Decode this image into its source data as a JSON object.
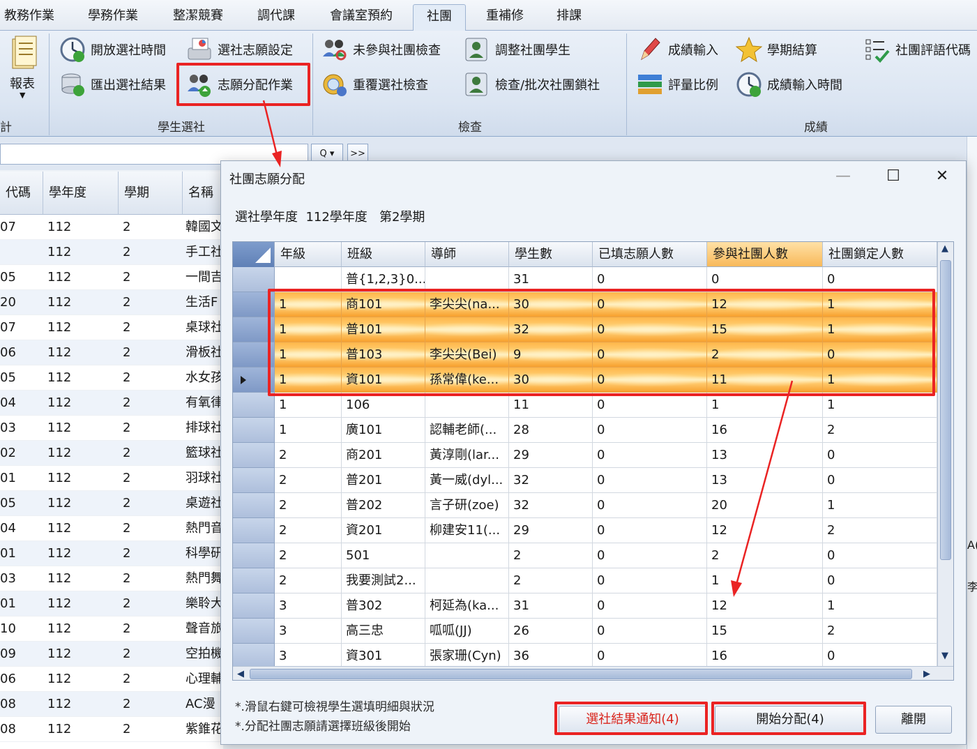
{
  "tabs": [
    {
      "label": "教務作業",
      "active": false
    },
    {
      "label": "學務作業",
      "active": false
    },
    {
      "label": "整潔競賽",
      "active": false
    },
    {
      "label": "調代課",
      "active": false
    },
    {
      "label": "會議室預約",
      "active": false
    },
    {
      "label": "社團",
      "active": true
    },
    {
      "label": "重補修",
      "active": false
    },
    {
      "label": "排課",
      "active": false
    }
  ],
  "ribbon": {
    "report_label": "報表",
    "partial_group_label": "計",
    "groups": {
      "select": "學生選社",
      "check": "檢查",
      "grade": "成績"
    },
    "buttons": {
      "open_time": "開放選社時間",
      "pref_setting": "選社志願設定",
      "export_result": "匯出選社結果",
      "pref_assign": "志願分配作業",
      "not_joined_check": "未參與社團檢查",
      "adjust_students": "調整社團學生",
      "duplicate_check": "重覆選社檢查",
      "check_lock": "檢查/批次社團鎖社",
      "grade_input": "成績輸入",
      "semester_settle": "學期結算",
      "comment_code": "社團評語代碼",
      "ratio": "評量比例",
      "grade_time": "成績輸入時間"
    }
  },
  "search": {
    "search_button": "Q ▾",
    "more_button": ">>"
  },
  "background_grid": {
    "headers": [
      "代碼",
      "學年度",
      "學期",
      "名稱"
    ],
    "rows": [
      [
        "07",
        "112",
        "2",
        "韓國文"
      ],
      [
        "",
        "112",
        "2",
        "手工社"
      ],
      [
        "05",
        "112",
        "2",
        "一間吉"
      ],
      [
        "20",
        "112",
        "2",
        "生活F"
      ],
      [
        "07",
        "112",
        "2",
        "桌球社"
      ],
      [
        "06",
        "112",
        "2",
        "滑板社"
      ],
      [
        "05",
        "112",
        "2",
        "水女孩"
      ],
      [
        "04",
        "112",
        "2",
        "有氧律"
      ],
      [
        "03",
        "112",
        "2",
        "排球社"
      ],
      [
        "02",
        "112",
        "2",
        "籃球社"
      ],
      [
        "01",
        "112",
        "2",
        "羽球社"
      ],
      [
        "05",
        "112",
        "2",
        "桌遊社"
      ],
      [
        "04",
        "112",
        "2",
        "熱門音"
      ],
      [
        "01",
        "112",
        "2",
        "科學研"
      ],
      [
        "03",
        "112",
        "2",
        "熱門舞"
      ],
      [
        "01",
        "112",
        "2",
        "樂聆大"
      ],
      [
        "10",
        "112",
        "2",
        "聲音旅"
      ],
      [
        "09",
        "112",
        "2",
        "空拍機"
      ],
      [
        "06",
        "112",
        "2",
        "心理輔"
      ],
      [
        "08",
        "112",
        "2",
        "AC漫"
      ],
      [
        "08",
        "112",
        "2",
        "紫錐花"
      ]
    ]
  },
  "right_peek": {
    "a": "A(",
    "b": "李"
  },
  "dialog": {
    "title": "社團志願分配",
    "min": "—",
    "max": "☐",
    "close": "✕",
    "year_label": "選社學年度",
    "year_value": "112學年度",
    "semester_value": "第2學期",
    "columns": [
      "年級",
      "班級",
      "導師",
      "學生數",
      "已填志願人數",
      "參與社團人數",
      "社團鎖定人數"
    ],
    "highlighted_column": 5,
    "rows": [
      {
        "grade": "",
        "class": "普{1,2,3}0...",
        "teacher": "",
        "students": "31",
        "filled": "0",
        "joined": "0",
        "locked": "0"
      },
      {
        "grade": "1",
        "class": "商101",
        "teacher": "李尖尖(na...",
        "students": "30",
        "filled": "0",
        "joined": "12",
        "locked": "1"
      },
      {
        "grade": "1",
        "class": "普101",
        "teacher": "",
        "students": "32",
        "filled": "0",
        "joined": "15",
        "locked": "1"
      },
      {
        "grade": "1",
        "class": "普103",
        "teacher": "李尖尖(Bei)",
        "students": "9",
        "filled": "0",
        "joined": "2",
        "locked": "0"
      },
      {
        "grade": "1",
        "class": "資101",
        "teacher": "孫常偉(ke...",
        "students": "30",
        "filled": "0",
        "joined": "11",
        "locked": "1"
      },
      {
        "grade": "1",
        "class": "106",
        "teacher": "",
        "students": "11",
        "filled": "0",
        "joined": "1",
        "locked": "1"
      },
      {
        "grade": "1",
        "class": "廣101",
        "teacher": "認輔老師(...",
        "students": "28",
        "filled": "0",
        "joined": "16",
        "locked": "2"
      },
      {
        "grade": "2",
        "class": "商201",
        "teacher": "黃淳剛(lar...",
        "students": "29",
        "filled": "0",
        "joined": "13",
        "locked": "0"
      },
      {
        "grade": "2",
        "class": "普201",
        "teacher": "黃一威(dyl...",
        "students": "32",
        "filled": "0",
        "joined": "13",
        "locked": "0"
      },
      {
        "grade": "2",
        "class": "普202",
        "teacher": "言子研(zoe)",
        "students": "32",
        "filled": "0",
        "joined": "20",
        "locked": "1"
      },
      {
        "grade": "2",
        "class": "資201",
        "teacher": "柳建安11(...",
        "students": "29",
        "filled": "0",
        "joined": "12",
        "locked": "2"
      },
      {
        "grade": "2",
        "class": "501",
        "teacher": "",
        "students": "2",
        "filled": "0",
        "joined": "2",
        "locked": "0"
      },
      {
        "grade": "2",
        "class": "我要測試2...",
        "teacher": "",
        "students": "2",
        "filled": "0",
        "joined": "1",
        "locked": "0"
      },
      {
        "grade": "3",
        "class": "普302",
        "teacher": "柯延為(ka...",
        "students": "31",
        "filled": "0",
        "joined": "12",
        "locked": "1"
      },
      {
        "grade": "3",
        "class": "高三忠",
        "teacher": "呱呱(JJ)",
        "students": "26",
        "filled": "0",
        "joined": "15",
        "locked": "2"
      },
      {
        "grade": "3",
        "class": "資301",
        "teacher": "張家珊(Cyn)",
        "students": "36",
        "filled": "0",
        "joined": "16",
        "locked": "0"
      }
    ],
    "selected_rows": [
      1,
      2,
      3,
      4
    ],
    "current_row": 4,
    "notes": [
      "*.滑鼠右鍵可檢視學生選填明細與狀況",
      "*.分配社團志願請選擇班級後開始"
    ],
    "buttons": {
      "notify": "選社結果通知(4)",
      "start": "開始分配(4)",
      "leave": "離開"
    },
    "notify_color": "#d9251c"
  },
  "annotation_color": "#ea2323"
}
